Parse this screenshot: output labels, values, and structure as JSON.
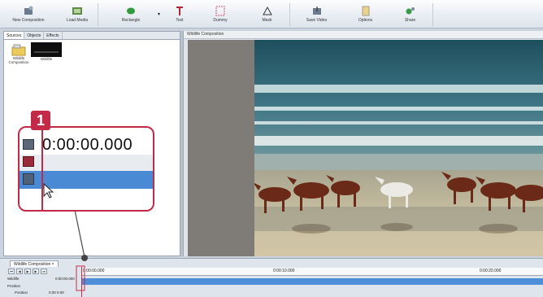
{
  "toolbar": {
    "buttons": [
      {
        "label": "New Composition",
        "icon": "new-composition-icon"
      },
      {
        "label": "Load Media",
        "icon": "load-media-icon"
      },
      {
        "label": "Rectangle",
        "icon": "rectangle-icon"
      },
      {
        "label": "Text",
        "icon": "text-icon"
      },
      {
        "label": "Dummy",
        "icon": "dummy-icon"
      },
      {
        "label": "Mask",
        "icon": "mask-icon"
      },
      {
        "label": "Save Video",
        "icon": "save-video-icon"
      },
      {
        "label": "Options",
        "icon": "options-icon"
      },
      {
        "label": "Share",
        "icon": "share-icon"
      }
    ]
  },
  "left_panel": {
    "tabs": [
      "Sources",
      "Objects",
      "Effects"
    ],
    "items": [
      {
        "label": "Wildlife Composition",
        "icon": "composition-icon"
      },
      {
        "label": "Wildlife",
        "icon": "video-thumbnail-icon"
      }
    ]
  },
  "preview": {
    "title": "Wildlife Composition"
  },
  "callout": {
    "number": "1",
    "timecode": "0:00:00.000"
  },
  "timeline": {
    "tab": "Wildlife Composition ×",
    "times": [
      "0:00:00.000",
      "0:00:10.000",
      "0:00:20.000"
    ],
    "tracks": [
      {
        "label": "Wildlife",
        "info": "0:00:00.000"
      },
      {
        "label": "Position"
      },
      {
        "label": "Position",
        "values": "0.00  0.00"
      }
    ]
  },
  "colors": {
    "accent": "#c32a47",
    "track_blue": "#4a8ad5"
  }
}
